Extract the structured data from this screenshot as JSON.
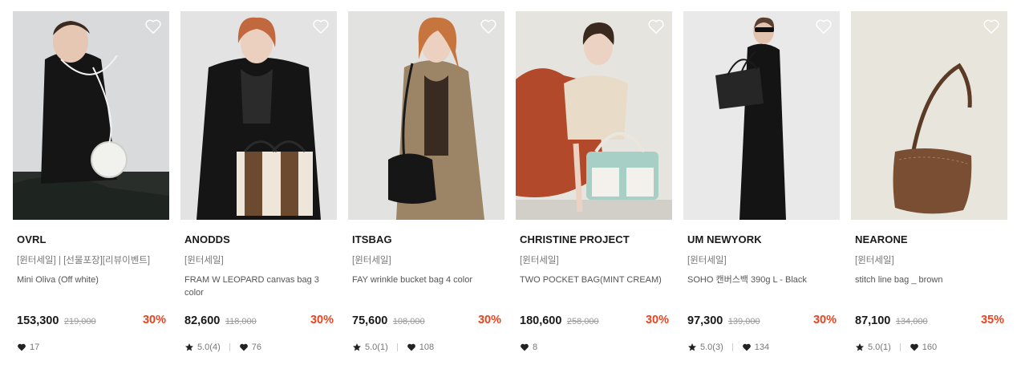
{
  "products": [
    {
      "brand": "OVRL",
      "tags": "[윈터세일] | [선물포장][리뷰이벤트]",
      "name": "Mini Oliva (Off white)",
      "price": "153,300",
      "original_price": "219,000",
      "discount": "30%",
      "rating": null,
      "likes": "17"
    },
    {
      "brand": "ANODDS",
      "tags": "[윈터세일]",
      "name": "FRAM W LEOPARD canvas bag 3 color",
      "price": "82,600",
      "original_price": "118,000",
      "discount": "30%",
      "rating": "5.0(4)",
      "likes": "76"
    },
    {
      "brand": "ITSBAG",
      "tags": "[윈터세일]",
      "name": "FAY wrinkle bucket bag 4 color",
      "price": "75,600",
      "original_price": "108,000",
      "discount": "30%",
      "rating": "5.0(1)",
      "likes": "108"
    },
    {
      "brand": "CHRISTINE PROJECT",
      "tags": "[윈터세일]",
      "name": "TWO POCKET BAG(MINT CREAM)",
      "price": "180,600",
      "original_price": "258,000",
      "discount": "30%",
      "rating": null,
      "likes": "8"
    },
    {
      "brand": "UM NEWYORK",
      "tags": "[윈터세일]",
      "name": "SOHO 캔버스백 390g L - Black",
      "price": "97,300",
      "original_price": "139,000",
      "discount": "30%",
      "rating": "5.0(3)",
      "likes": "134"
    },
    {
      "brand": "NEARONE",
      "tags": "[윈터세일]",
      "name": "stitch line bag _ brown",
      "price": "87,100",
      "original_price": "134,000",
      "discount": "35%",
      "rating": "5.0(1)",
      "likes": "160"
    }
  ],
  "icons": {
    "wishlist": "heart-outline-icon",
    "rating": "star-icon",
    "likes": "heart-icon"
  },
  "colors": {
    "discount": "#e8431f",
    "text": "#1a1a1a",
    "muted": "#777777"
  }
}
